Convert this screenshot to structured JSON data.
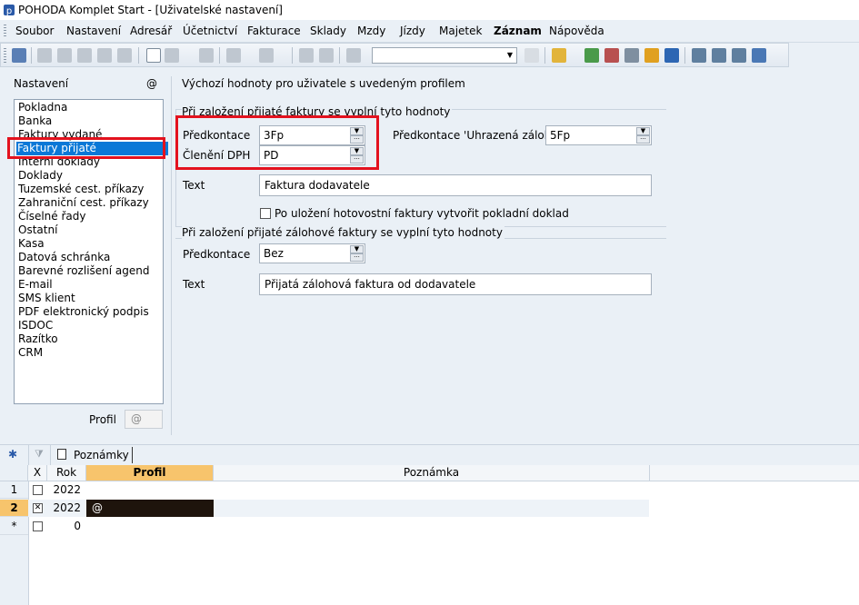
{
  "window": {
    "title": "POHODA Komplet Start - [Uživatelské nastavení]"
  },
  "menu": [
    "Soubor",
    "Nastavení",
    "Adresář",
    "Účetnictví",
    "Fakturace",
    "Sklady",
    "Mzdy",
    "Jízdy",
    "Majetek",
    "Záznam",
    "Nápověda"
  ],
  "left": {
    "label": "Nastavení",
    "at_symbol": "@",
    "items": [
      "Pokladna",
      "Banka",
      "Faktury vydané",
      "Faktury přijaté",
      "Interní doklady",
      "Doklady",
      "Tuzemské cest. příkazy",
      "Zahraniční cest. příkazy",
      "Číselné řady",
      "Ostatní",
      "Kasa",
      "Datová schránka",
      "Barevné rozlišení agend",
      "E-mail",
      "SMS klient",
      "PDF elektronický podpis",
      "ISDOC",
      "Razítko",
      "CRM"
    ],
    "selected_index": 3,
    "profil_label": "Profil",
    "profil_value": "@"
  },
  "main": {
    "title": "Výchozí hodnoty pro uživatele s uvedeným profilem",
    "group1": {
      "label": "Při založení přijaté faktury se vyplní tyto hodnoty",
      "predkontace_label": "Předkontace",
      "predkontace_value": "3Fp",
      "cleneni_label": "Členění DPH",
      "cleneni_value": "PD",
      "uhrazena_label": "Předkontace 'Uhrazená záloha'",
      "uhrazena_value": "5Fp",
      "text_label": "Text",
      "text_value": "Faktura dodavatele",
      "checkbox_label": "Po uložení hotovostní faktury vytvořit pokladní doklad"
    },
    "group2": {
      "label": "Při založení přijaté zálohové faktury se vyplní tyto hodnoty",
      "predkontace_label": "Předkontace",
      "predkontace_value": "Bez",
      "text_label": "Text",
      "text_value": "Přijatá zálohová faktura od dodavatele"
    }
  },
  "bottom": {
    "star": "✱",
    "tab_label": "Poznámky",
    "columns": [
      "X",
      "Rok",
      "Profil",
      "Poznámka"
    ],
    "rows": [
      {
        "num": "1",
        "checked": false,
        "rok": "2022",
        "profil": ""
      },
      {
        "num": "2",
        "checked": true,
        "rok": "2022",
        "profil": "@"
      },
      {
        "num": "*",
        "checked": false,
        "rok": "0",
        "profil": ""
      }
    ]
  },
  "colors": {
    "accent": "#0a78d7",
    "highlight_red": "#e3121e",
    "profil_header": "#f7c46c"
  }
}
